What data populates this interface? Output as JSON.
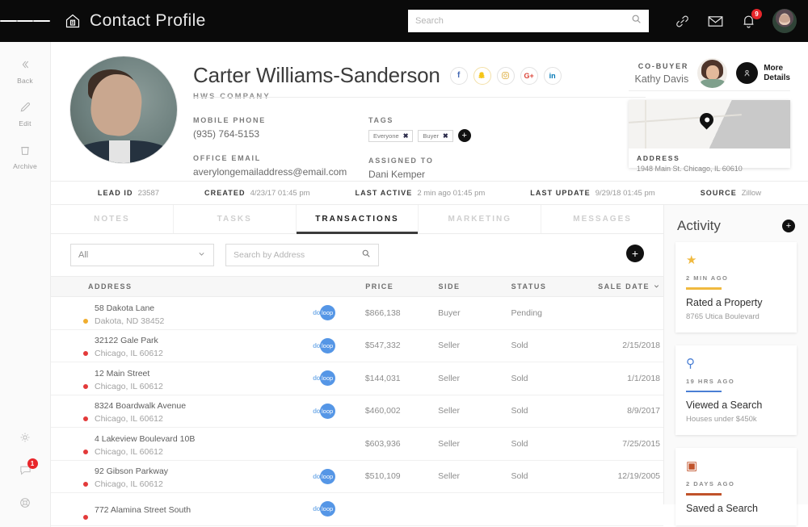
{
  "topbar": {
    "menu_icon": "hamburger-icon",
    "logo_icon": "house-logo-icon",
    "title": "Contact Profile",
    "search_placeholder": "Search",
    "search_value": "",
    "link_icon": "link-icon",
    "mail_icon": "envelope-icon",
    "bell_icon": "bell-icon",
    "notification_count": "9",
    "avatar": "user-avatar"
  },
  "rail": {
    "items": [
      {
        "label": "Back",
        "icon": "chevron-left-double-icon"
      },
      {
        "label": "Edit",
        "icon": "pencil-icon"
      },
      {
        "label": "Archive",
        "icon": "trash-icon"
      }
    ],
    "bottom": [
      {
        "icon": "gear-icon",
        "badge": ""
      },
      {
        "icon": "chat-bubble-icon",
        "badge": "1"
      },
      {
        "icon": "lifebuoy-icon",
        "badge": ""
      }
    ]
  },
  "profile": {
    "name": "Carter Williams-Sanderson",
    "company": "HWS COMPANY",
    "socials": [
      {
        "name": "facebook-icon",
        "glyph": "f"
      },
      {
        "name": "snapchat-icon",
        "glyph": "●"
      },
      {
        "name": "instagram-icon",
        "glyph": "◎"
      },
      {
        "name": "google-plus-icon",
        "glyph": "G+"
      },
      {
        "name": "linkedin-icon",
        "glyph": "in"
      }
    ],
    "fields": {
      "mobile_phone_label": "MOBILE PHONE",
      "mobile_phone": "(935) 764-5153",
      "office_email_label": "OFFICE EMAIL",
      "office_email": "averylongemailaddress@email.com",
      "tags_label": "TAGS",
      "assigned_to_label": "ASSIGNED TO",
      "assigned_to": "Dani Kemper"
    },
    "tags": [
      "Everyone",
      "Buyer"
    ],
    "add_tag_label": "+",
    "cobuyer_label": "CO-BUYER",
    "cobuyer_name": "Kathy Davis",
    "more_details_line1": "More",
    "more_details_line2": "Details",
    "address_label": "ADDRESS",
    "address_value": "1948 Main St.  Chicago, IL 60610"
  },
  "meta": [
    {
      "key": "LEAD ID",
      "value": "23587"
    },
    {
      "key": "CREATED",
      "value": "4/23/17  01:45 pm"
    },
    {
      "key": "LAST ACTIVE",
      "value": "2 min ago 01:45 pm"
    },
    {
      "key": "LAST UPDATE",
      "value": "9/29/18 01:45 pm"
    },
    {
      "key": "SOURCE",
      "value": "Zillow"
    }
  ],
  "tabs": [
    {
      "label": "NOTES",
      "active": false
    },
    {
      "label": "TASKS",
      "active": false
    },
    {
      "label": "TRANSACTIONS",
      "active": true
    },
    {
      "label": "MARKETING",
      "active": false
    },
    {
      "label": "MESSAGES",
      "active": false
    }
  ],
  "filters": {
    "select_value": "All",
    "search_placeholder": "Search by Address",
    "search_value": "",
    "add_label": "+"
  },
  "table": {
    "columns": [
      "ADDRESS",
      "PRICE",
      "SIDE",
      "STATUS",
      "SALE DATE"
    ],
    "sort_column": "SALE DATE",
    "rows": [
      {
        "address1": "58 Dakota Lane",
        "address2": "Dakota, ND 38452",
        "loop": "dotloop",
        "price": "$866,138",
        "side": "Buyer",
        "status": "Pending",
        "date": "",
        "dot": "#f0ad2e"
      },
      {
        "address1": "32122 Gale Park",
        "address2": "Chicago, IL 60612",
        "loop": "dotloop",
        "price": "$547,332",
        "side": "Seller",
        "status": "Sold",
        "date": "2/15/2018",
        "dot": "#e33a3a"
      },
      {
        "address1": "12 Main Street",
        "address2": "Chicago, IL 60612",
        "loop": "dotloop",
        "price": "$144,031",
        "side": "Seller",
        "status": "Sold",
        "date": "1/1/2018",
        "dot": "#e33a3a"
      },
      {
        "address1": "8324 Boardwalk Avenue",
        "address2": "Chicago, IL 60612",
        "loop": "dotloop",
        "price": "$460,002",
        "side": "Seller",
        "status": "Sold",
        "date": "8/9/2017",
        "dot": "#e33a3a"
      },
      {
        "address1": "4 Lakeview Boulevard 10B",
        "address2": "Chicago, IL 60612",
        "loop": "",
        "price": "$603,936",
        "side": "Seller",
        "status": "Sold",
        "date": "7/25/2015",
        "dot": "#e33a3a"
      },
      {
        "address1": "92 Gibson Parkway",
        "address2": "Chicago, IL 60612",
        "loop": "dotloop",
        "price": "$510,109",
        "side": "Seller",
        "status": "Sold",
        "date": "12/19/2005",
        "dot": "#e33a3a"
      },
      {
        "address1": "772 Alamina Street South",
        "address2": "",
        "loop": "dotloop",
        "price": "",
        "side": "",
        "status": "",
        "date": "",
        "dot": "#e33a3a"
      }
    ]
  },
  "activity": {
    "title": "Activity",
    "add_label": "+",
    "cards": [
      {
        "icon": "star-icon",
        "glyph": "★",
        "color": "#f0b93f",
        "time": "2 MIN AGO",
        "title": "Rated a Property",
        "subtitle": "8765 Utica Boulevard"
      },
      {
        "icon": "search-icon",
        "glyph": "⚲",
        "color": "#4a7fd4",
        "time": "19 HRS AGO",
        "title": "Viewed a Search",
        "subtitle": "Houses under $450k"
      },
      {
        "icon": "save-disk-icon",
        "glyph": "▣",
        "color": "#c0522a",
        "time": "2 DAYS AGO",
        "title": "Saved a Search",
        "subtitle": ""
      }
    ]
  }
}
